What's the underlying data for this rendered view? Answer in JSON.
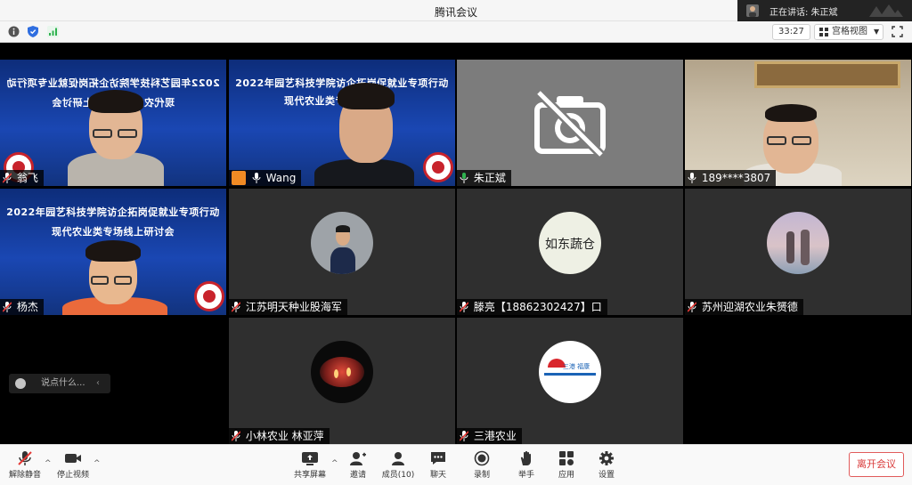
{
  "window": {
    "title": "腾讯会议"
  },
  "speaking": {
    "label": "正在讲话: 朱正斌"
  },
  "infobar": {
    "timer": "33:27",
    "view_label": "宫格视图"
  },
  "tiles": [
    {
      "name": "翁飞",
      "banner1": "2022年园艺科技学院访企拓岗促就业专项行动",
      "banner2": "现代农业类专场线上研讨会"
    },
    {
      "name": "Wang",
      "banner1": "2022年园艺科技学院访企拓岗促就业专项行动",
      "banner2": "现代农业类专场"
    },
    {
      "name": "朱正斌"
    },
    {
      "name": "189****3807"
    },
    {
      "name": "杨杰",
      "banner1": "2022年园艺科技学院访企拓岗促就业专项行动",
      "banner2": "现代农业类专场线上研讨会"
    },
    {
      "name": "江苏明天种业股海军"
    },
    {
      "name": "滕亮【18862302427】口",
      "avatar_text": "如东蔬仓"
    },
    {
      "name": "苏州迎湖农业朱赟德"
    },
    {
      "name": "小林农业 林亚萍"
    },
    {
      "name": "三港农业",
      "avatar_text": "三港 福康"
    }
  ],
  "chat": {
    "placeholder": "说点什么...",
    "arrow": "‹"
  },
  "toolbar": {
    "unmute": "解除静音",
    "stop_video": "停止视频",
    "share": "共享屏幕",
    "invite": "邀请",
    "members": "成员(10)",
    "chat": "聊天",
    "record": "录制",
    "raise_hand": "举手",
    "apps": "应用",
    "settings": "设置",
    "leave": "离开会议"
  },
  "colors": {
    "accent_orange": "#f08a24",
    "leave_red": "#d93a3a",
    "mic_green": "#2fb24f"
  }
}
